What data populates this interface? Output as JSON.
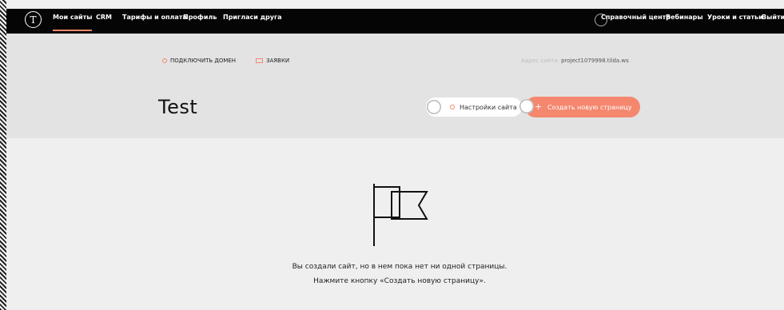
{
  "topbar": {
    "logo": "T",
    "nav": [
      "Мои сайты",
      "CRM",
      "Тарифы и оплата",
      "Профиль",
      "Пригласи друга"
    ],
    "right": [
      "Справочный центр",
      "Вебинары",
      "Уроки и статьи",
      "Выйти"
    ]
  },
  "project": {
    "connect_domain": "ПОДКЛЮЧИТЬ ДОМЕН",
    "leads": "ЗАЯВКИ",
    "address_label": "Адрес сайта:",
    "address_value": "project1079998.tilda.ws",
    "title": "Test",
    "settings_button": "Настройки сайта",
    "create_button": "Создать новую страницу"
  },
  "empty_state": {
    "line1": "Вы создали сайт, но в нем пока нет ни одной страницы.",
    "line2": "Нажмите кнопку «Создать новую страницу»."
  },
  "colors": {
    "accent": "#f4876e",
    "topbar": "#050505",
    "hero": "#e3e3e3",
    "page": "#efefef"
  }
}
